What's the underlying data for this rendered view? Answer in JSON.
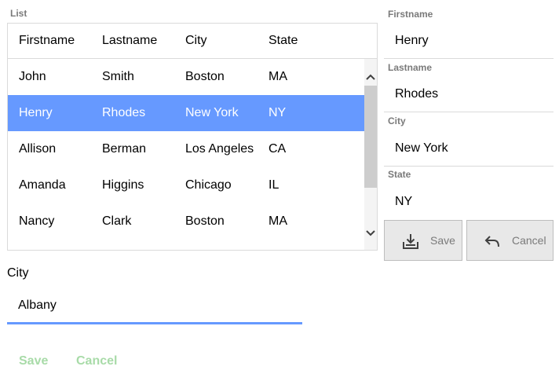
{
  "list": {
    "caption": "List",
    "columns": [
      "Firstname",
      "Lastname",
      "City",
      "State"
    ],
    "rows": [
      [
        "John",
        "Smith",
        "Boston",
        "MA"
      ],
      [
        "Henry",
        "Rhodes",
        "New York",
        "NY"
      ],
      [
        "Allison",
        "Berman",
        "Los Angeles",
        "CA"
      ],
      [
        "Amanda",
        "Higgins",
        "Chicago",
        "IL"
      ],
      [
        "Nancy",
        "Clark",
        "Boston",
        "MA"
      ]
    ],
    "selected_row": 1
  },
  "city_editor": {
    "label": "City",
    "value": "Albany",
    "save_label": "Save",
    "cancel_label": "Cancel"
  },
  "form": {
    "firstname_label": "Firstname",
    "firstname_value": "Henry",
    "lastname_label": "Lastname",
    "lastname_value": "Rhodes",
    "city_label": "City",
    "city_value": "New York",
    "state_label": "State",
    "state_value": "NY",
    "save_label": "Save",
    "cancel_label": "Cancel",
    "save_icon": "download-tray-icon",
    "cancel_icon": "undo-arrow-icon"
  },
  "colors": {
    "selection": "#6699ff",
    "accent_underline": "#6699ff",
    "disabled_link": "#a8dba8",
    "label_gray": "#7a7a7a"
  }
}
